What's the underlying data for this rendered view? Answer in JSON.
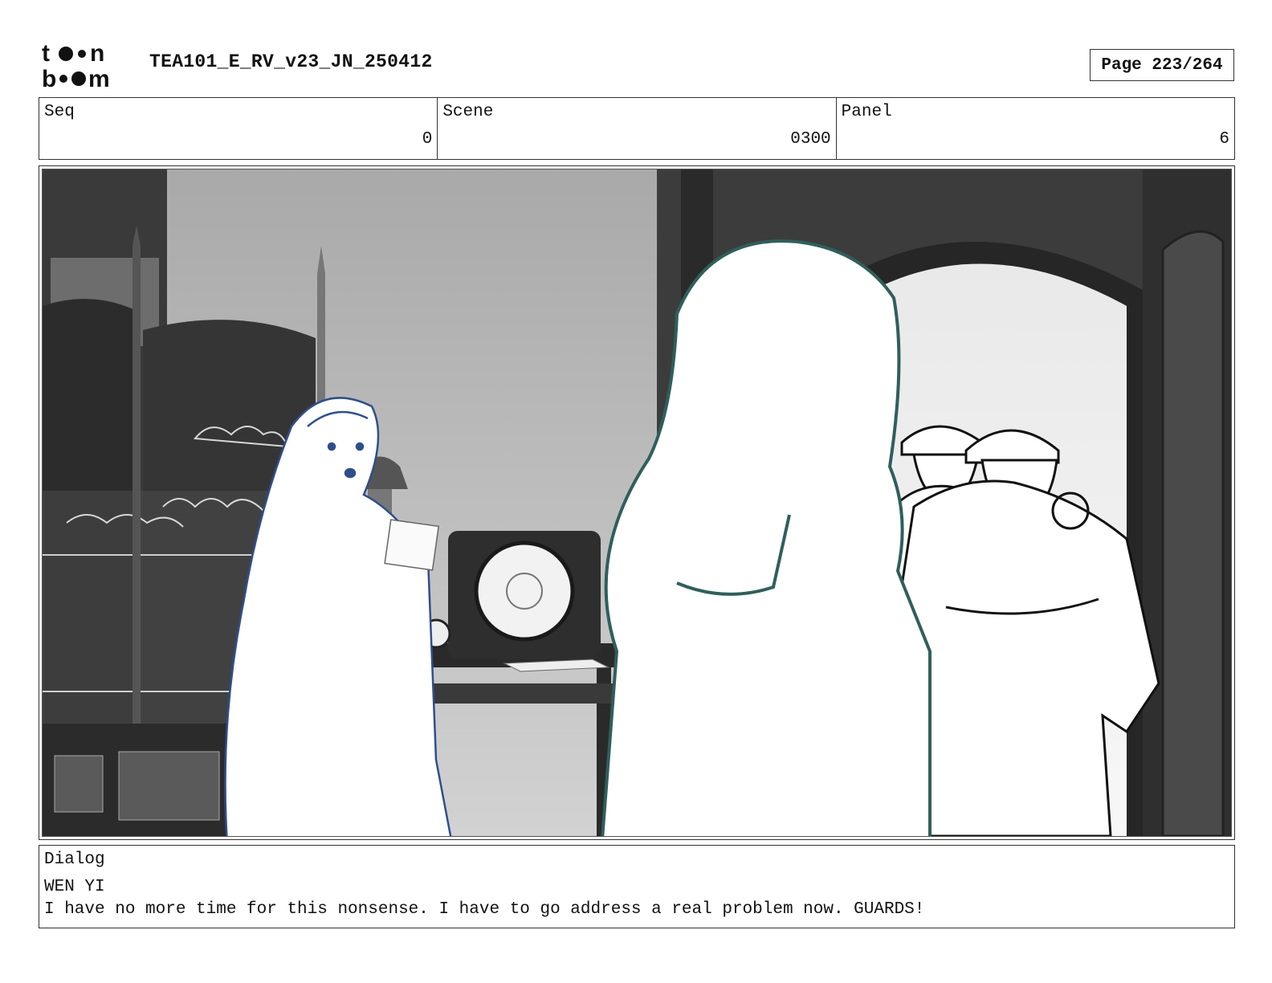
{
  "header": {
    "logo_text": "toon boom",
    "doc_title": "TEA101_E_RV_v23_JN_250412",
    "page_indicator": "Page 223/264"
  },
  "info": {
    "seq_label": "Seq",
    "seq_value": "0",
    "scene_label": "Scene",
    "scene_value": "0300",
    "panel_label": "Panel",
    "panel_value": "6"
  },
  "panel_image": {
    "description_icon": "storyboard-panel-image"
  },
  "dialog": {
    "label": "Dialog",
    "speaker": "WEN YI",
    "line": "I have no more time for this nonsense. I have to go address a real problem now. GUARDS!"
  },
  "colors": {
    "frame": "#333333",
    "wenyi_outline": "#2e4f8c",
    "foreground_outline": "#2f5f5c",
    "guard_outline": "#111111"
  }
}
